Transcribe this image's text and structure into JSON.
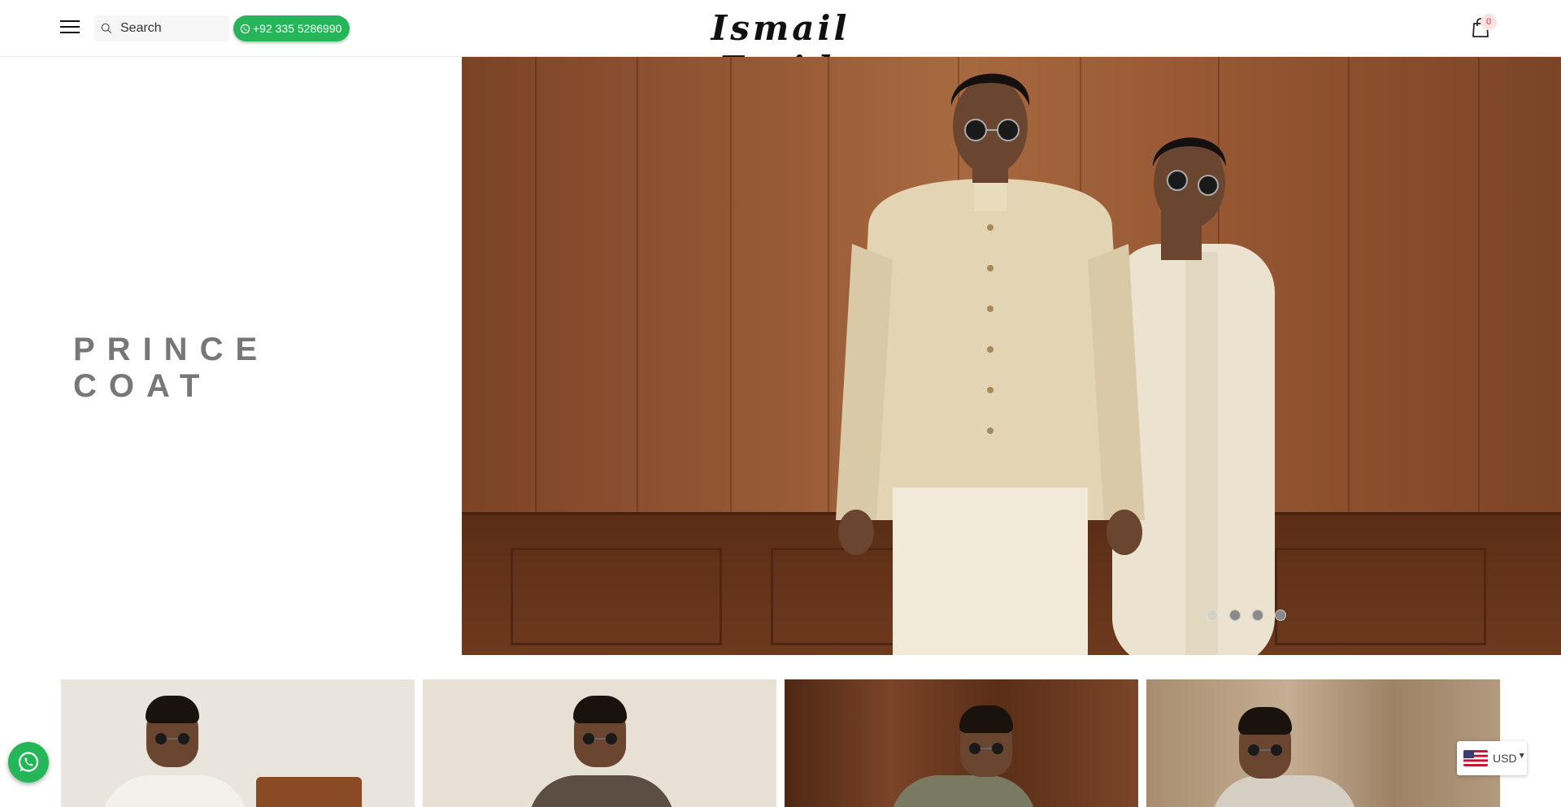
{
  "header": {
    "search_placeholder": "Search",
    "phone": "+92 335 5286990",
    "logo_text": "Ismail Farid",
    "logo_tm": "™",
    "cart_count": "0"
  },
  "hero": {
    "title": "PRINCE COAT",
    "slides_total": 4,
    "active_slide": 1
  },
  "tiles": [
    {
      "label": "product-tile-1",
      "bg": "#e9e4dc",
      "garment": "#f3f1ec"
    },
    {
      "label": "product-tile-2",
      "bg": "#e6e0d5",
      "garment": "#5d4e43"
    },
    {
      "label": "product-tile-3",
      "bg": "#6b3b22",
      "garment": "#7a7a62"
    },
    {
      "label": "product-tile-4",
      "bg": "#b39a7e",
      "garment": "#d5cfc3"
    }
  ],
  "currency": {
    "code": "USD"
  },
  "colors": {
    "whatsapp_green": "#25b65a",
    "hero_text": "#777777",
    "wood": "#955632"
  },
  "icons": {
    "menu": "hamburger-menu-icon",
    "search": "search-icon",
    "whatsapp": "whatsapp-icon",
    "cart": "shopping-bag-icon",
    "flag": "us-flag-icon"
  }
}
